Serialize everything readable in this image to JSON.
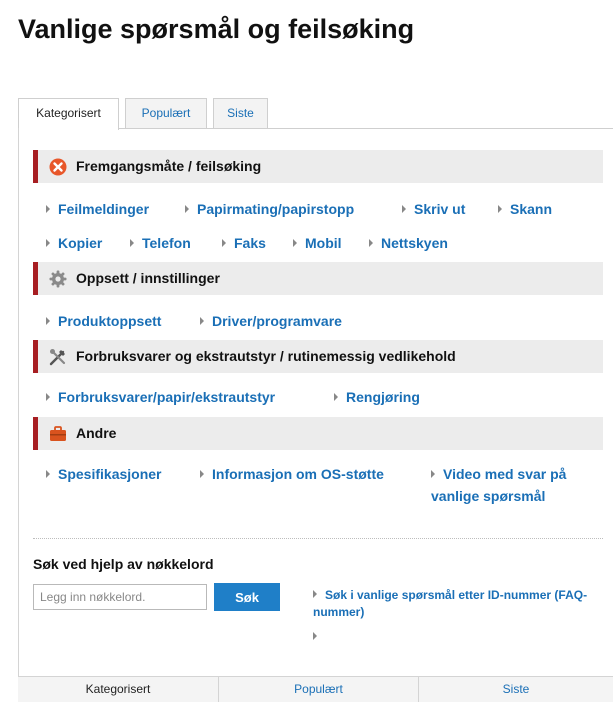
{
  "title": "Vanlige spørsmål og feilsøking",
  "tabs": [
    "Kategorisert",
    "Populært",
    "Siste"
  ],
  "sections": [
    {
      "title": "Fremgangsmåte / feilsøking",
      "icon": "error-x-icon",
      "links": [
        "Feilmeldinger",
        "Papirmating/papirstopp",
        "Skriv ut",
        "Skann",
        "Kopier",
        "Telefon",
        "Faks",
        "Mobil",
        "Nettskyen"
      ]
    },
    {
      "title": "Oppsett / innstillinger",
      "icon": "gear-icon",
      "links": [
        "Produktoppsett",
        "Driver/programvare"
      ]
    },
    {
      "title": "Forbruksvarer og ekstrautstyr / rutinemessig vedlikehold",
      "icon": "tools-icon",
      "links": [
        "Forbruksvarer/papir/ekstrautstyr",
        "Rengjøring"
      ]
    },
    {
      "title": "Andre",
      "icon": "toolbox-icon",
      "links": [
        "Spesifikasjoner",
        "Informasjon om OS-støtte",
        "Video med svar på vanlige spørsmål"
      ]
    }
  ],
  "search": {
    "label": "Søk ved hjelp av nøkkelord",
    "placeholder": "Legg inn nøkkelord.",
    "button": "Søk",
    "id_link": "Søk i vanlige spørsmål etter ID-nummer (FAQ-nummer)"
  },
  "bottom_tabs": [
    "Kategorisert",
    "Populært",
    "Siste"
  ],
  "colors": {
    "link": "#1a6fb6",
    "accent": "#a71e22",
    "button": "#1f7fc8"
  }
}
